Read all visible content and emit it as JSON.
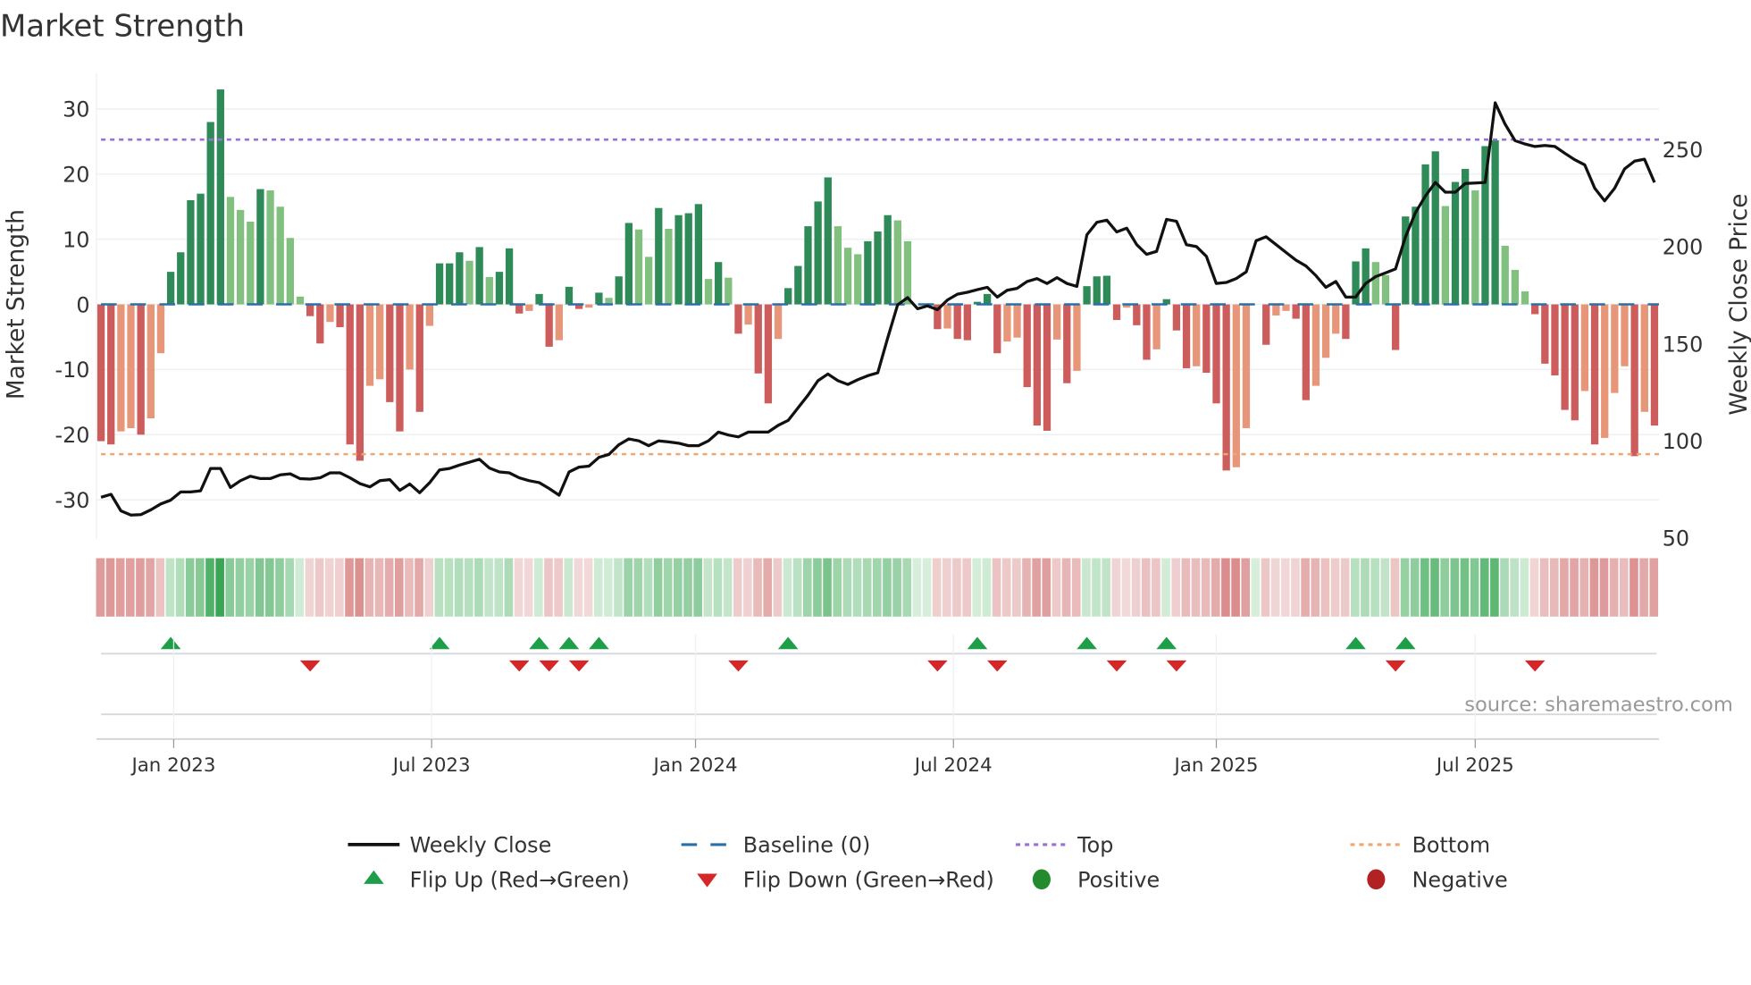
{
  "chart_data": {
    "type": "bar",
    "title": "Market Strength",
    "ylabel": "Market Strength",
    "y2label": "Weekly Close Price",
    "ylim": [
      -36,
      36
    ],
    "y2lim": [
      50,
      290
    ],
    "yticks": [
      "-30",
      "-20",
      "-10",
      "0",
      "10",
      "20",
      "30"
    ],
    "y2ticks": [
      "50",
      "100",
      "150",
      "200",
      "250"
    ],
    "xticks": [
      {
        "label": "Jan 2023",
        "week": 7.3
      },
      {
        "label": "Jul 2023",
        "week": 33.2
      },
      {
        "label": "Jan 2024",
        "week": 59.7
      },
      {
        "label": "Jul 2024",
        "week": 85.6
      },
      {
        "label": "Jan 2025",
        "week": 112
      },
      {
        "label": "Jul 2025",
        "week": 138
      }
    ],
    "top_level": 25.3,
    "bottom_level": -23.0,
    "baseline": 0,
    "strength": [
      -21,
      -21.5,
      -19.5,
      -19,
      -20,
      -17.5,
      -7.5,
      5,
      8,
      16,
      17,
      28,
      33,
      16.5,
      14.5,
      12.7,
      17.7,
      17.5,
      15,
      10.2,
      1.2,
      -1.8,
      -6,
      -2.7,
      -3.5,
      -21.5,
      -24,
      -12.5,
      -11.5,
      -15,
      -19.5,
      -10,
      -16.5,
      -3.3,
      6.3,
      6.3,
      8,
      6.7,
      8.8,
      4.2,
      5,
      8.6,
      -1.4,
      -1,
      1.6,
      -6.5,
      -5.5,
      2.7,
      -0.7,
      -0.5,
      1.8,
      1,
      4.3,
      12.5,
      11.5,
      7.3,
      14.8,
      11.6,
      13.7,
      14,
      15.4,
      3.9,
      6.5,
      4.1,
      -4.5,
      -3.1,
      -10.6,
      -15.2,
      -5.3,
      2.5,
      5.9,
      12,
      15.8,
      19.5,
      12,
      8.7,
      7.7,
      9.7,
      11.2,
      13.7,
      12.9,
      9.7,
      0,
      0,
      -3.8,
      -3.7,
      -5.3,
      -5.5,
      0.4,
      1.6,
      -7.5,
      -5.7,
      -5.1,
      -12.7,
      -18.6,
      -19.4,
      -5.4,
      -12.1,
      -10.2,
      2.8,
      4.3,
      4.4,
      -2.4,
      -0.5,
      -3.2,
      -8.5,
      -6.9,
      0.8,
      -4,
      -9.8,
      -9.5,
      -10.5,
      -15.2,
      -25.5,
      -25,
      -19,
      0,
      -6.2,
      -1.7,
      -1,
      -2.2,
      -14.7,
      -12.5,
      -8.2,
      -4.5,
      -5.3,
      6.6,
      8.6,
      6.5,
      4.5,
      -7,
      13.5,
      15,
      21.5,
      23.5,
      15.1,
      18.8,
      20.8,
      17.5,
      24.3,
      25.2,
      9,
      5.3,
      2,
      -1.5,
      -9.1,
      -10.9,
      -16.2,
      -17.8,
      -13.3,
      -21.5,
      -20.5,
      -13.6,
      -9.5,
      -23.3,
      -16.5,
      -18.6
    ],
    "weekly_close": [
      71,
      72.5,
      64,
      61.8,
      62,
      64.5,
      67.5,
      69.5,
      73.7,
      73.7,
      74.3,
      85.8,
      85.8,
      76,
      79.5,
      81.8,
      80.6,
      80.6,
      82.5,
      83,
      80.5,
      80.3,
      81,
      83.5,
      83.5,
      81,
      78,
      76.3,
      79.5,
      80,
      74.5,
      77.8,
      73.3,
      78.5,
      85,
      85.8,
      87.5,
      89,
      90.5,
      86,
      84,
      83.5,
      81,
      79.5,
      78.5,
      75.5,
      72,
      84,
      86.5,
      87,
      91.5,
      93,
      98,
      101,
      100,
      97.5,
      100,
      99.5,
      98.8,
      97.5,
      97.5,
      100,
      104.5,
      103,
      102,
      104.5,
      104.5,
      104.5,
      108,
      110.5,
      117,
      123.5,
      131,
      134.4,
      131,
      129,
      131.5,
      133.5,
      135,
      153,
      170,
      173.7,
      168,
      169.5,
      167.5,
      172.5,
      175.5,
      176.5,
      177.8,
      179,
      174,
      177.5,
      178.5,
      182,
      183.5,
      181,
      184,
      181,
      179.5,
      206,
      212.5,
      213.6,
      207.5,
      209.5,
      201,
      196,
      197.5,
      214,
      213,
      201,
      200,
      195,
      181,
      181.5,
      183.5,
      187,
      203,
      205,
      201,
      197,
      193,
      190,
      185,
      179,
      182,
      174,
      174,
      181,
      184.5,
      186.5,
      188.5,
      205,
      217.5,
      226,
      233,
      228,
      228,
      232.5,
      232.7,
      233,
      274,
      263,
      254.5,
      252.8,
      251.5,
      252,
      251.5,
      248,
      244.7,
      242,
      230,
      223.5,
      230,
      240,
      244,
      245,
      233
    ],
    "source": "source: sharemaestro.com",
    "legend": [
      {
        "label": "Weekly Close",
        "kind": "line",
        "color": "#111111"
      },
      {
        "label": "Baseline (0)",
        "kind": "dash",
        "color": "#2b6fa8"
      },
      {
        "label": "Top",
        "kind": "dot",
        "color": "#9b6fd6"
      },
      {
        "label": "Bottom",
        "kind": "dot",
        "color": "#f0a673"
      },
      {
        "label": "Flip Up (Red→Green)",
        "kind": "tri-up",
        "color": "#1f9e4a"
      },
      {
        "label": "Flip Down (Green→Red)",
        "kind": "tri-down",
        "color": "#d62728"
      },
      {
        "label": "Positive",
        "kind": "circle",
        "color": "#238b2e"
      },
      {
        "label": "Negative",
        "kind": "circle",
        "color": "#b22222"
      }
    ],
    "colors": {
      "pos_strong": "#2e8b57",
      "pos_weak": "#81c07f",
      "neg_strong": "#cd5c5c",
      "neg_weak": "#e8967a"
    }
  }
}
